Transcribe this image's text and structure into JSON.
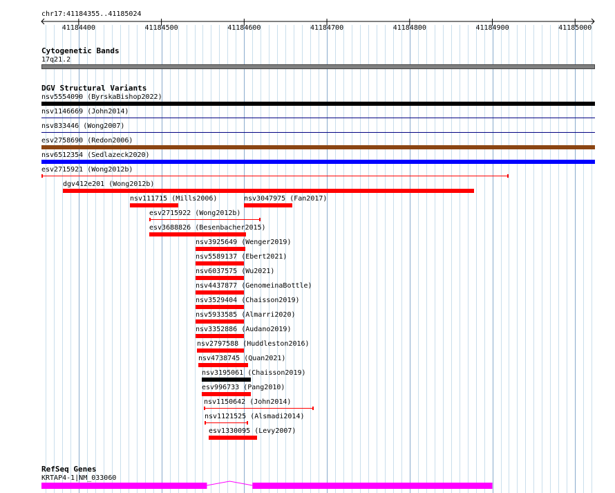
{
  "ruler": {
    "location": "chr17:41184355..41185024",
    "start": 41184355,
    "end": 41185024,
    "ticks": [
      "41184400",
      "41184500",
      "41184600",
      "41184700",
      "41184800",
      "41184900",
      "41185000"
    ]
  },
  "cytoband": {
    "title": "Cytogenetic Bands",
    "band": "17q21.2",
    "color": "#808080"
  },
  "dgv": {
    "title": "DGV Structural Variants",
    "full_width": [
      {
        "label": "nsv5554090 (ByrskaBishop2022)",
        "color": "#000000",
        "style": "thick"
      },
      {
        "label": "nsv1146669 (John2014)",
        "color": "#000080",
        "style": "thin"
      },
      {
        "label": "nsv833446 (Wong2007)",
        "color": "#000080",
        "style": "thin"
      },
      {
        "label": "esv2758690 (Redon2006)",
        "color": "#8b4513",
        "style": "thick"
      },
      {
        "label": "nsv6512354 (Sedlazeck2020)",
        "color": "#0000ff",
        "style": "thick"
      }
    ],
    "variants": [
      {
        "label": "esv2715921 (Wong2012b)",
        "start": 41184355,
        "end": 41184920,
        "color": "#ff0000",
        "style": "whisker"
      },
      {
        "label": "dgv412e201 (Wong2012b)",
        "start": 41184381,
        "end": 41184878,
        "color": "#ff0000",
        "style": "thick"
      },
      {
        "label": "nsv111715 (Mills2006)",
        "start": 41184462,
        "end": 41184520,
        "color": "#ff0000",
        "style": "thick"
      },
      {
        "label": "nsv3047975 (Fan2017)",
        "start": 41184600,
        "end": 41184658,
        "color": "#ff0000",
        "style": "thick"
      },
      {
        "label": "esv2715922 (Wong2012b)",
        "start": 41184485,
        "end": 41184620,
        "color": "#ff0000",
        "style": "whisker"
      },
      {
        "label": "esv3688826 (Besenbacher2015)",
        "start": 41184485,
        "end": 41184602,
        "color": "#ff0000",
        "style": "thick"
      },
      {
        "label": "nsv3925649 (Wenger2019)",
        "start": 41184541,
        "end": 41184601,
        "color": "#ff0000",
        "style": "thick"
      },
      {
        "label": "nsv5589137 (Ebert2021)",
        "start": 41184541,
        "end": 41184600,
        "color": "#ff0000",
        "style": "thick"
      },
      {
        "label": "nsv6037575 (Wu2021)",
        "start": 41184541,
        "end": 41184600,
        "color": "#ff0000",
        "style": "thick"
      },
      {
        "label": "nsv4437877 (GenomeinaBottle)",
        "start": 41184541,
        "end": 41184600,
        "color": "#ff0000",
        "style": "thick"
      },
      {
        "label": "nsv3529404 (Chaisson2019)",
        "start": 41184541,
        "end": 41184600,
        "color": "#ff0000",
        "style": "thick"
      },
      {
        "label": "nsv5933585 (Almarri2020)",
        "start": 41184541,
        "end": 41184600,
        "color": "#ff0000",
        "style": "thick"
      },
      {
        "label": "nsv3352886 (Audano2019)",
        "start": 41184541,
        "end": 41184600,
        "color": "#ff0000",
        "style": "thick"
      },
      {
        "label": "nsv2797588 (Huddleston2016)",
        "start": 41184543,
        "end": 41184600,
        "color": "#ff0000",
        "style": "thick"
      },
      {
        "label": "nsv4738745 (Quan2021)",
        "start": 41184545,
        "end": 41184605,
        "color": "#ff0000",
        "style": "thick"
      },
      {
        "label": "nsv3195061 (Chaisson2019)",
        "start": 41184549,
        "end": 41184608,
        "color": "#000000",
        "style": "thick"
      },
      {
        "label": "esv996733 (Pang2010)",
        "start": 41184549,
        "end": 41184608,
        "color": "#ff0000",
        "style": "thick"
      },
      {
        "label": "nsv1150642 (John2014)",
        "start": 41184551,
        "end": 41184684,
        "color": "#ff0000",
        "style": "whisker"
      },
      {
        "label": "nsv1121525 (Alsmadi2014)",
        "start": 41184552,
        "end": 41184605,
        "color": "#ff0000",
        "style": "whisker"
      },
      {
        "label": "esv1330095 (Levy2007)",
        "start": 41184557,
        "end": 41184616,
        "color": "#ff0000",
        "style": "thick"
      }
    ]
  },
  "refseq": {
    "title": "RefSeq Genes",
    "gene": "KRTAP4-1|NM_033060",
    "color": "#ff00ff",
    "exons": [
      {
        "start": 41184355,
        "end": 41184555
      },
      {
        "start": 41184610,
        "end": 41184900
      }
    ]
  }
}
